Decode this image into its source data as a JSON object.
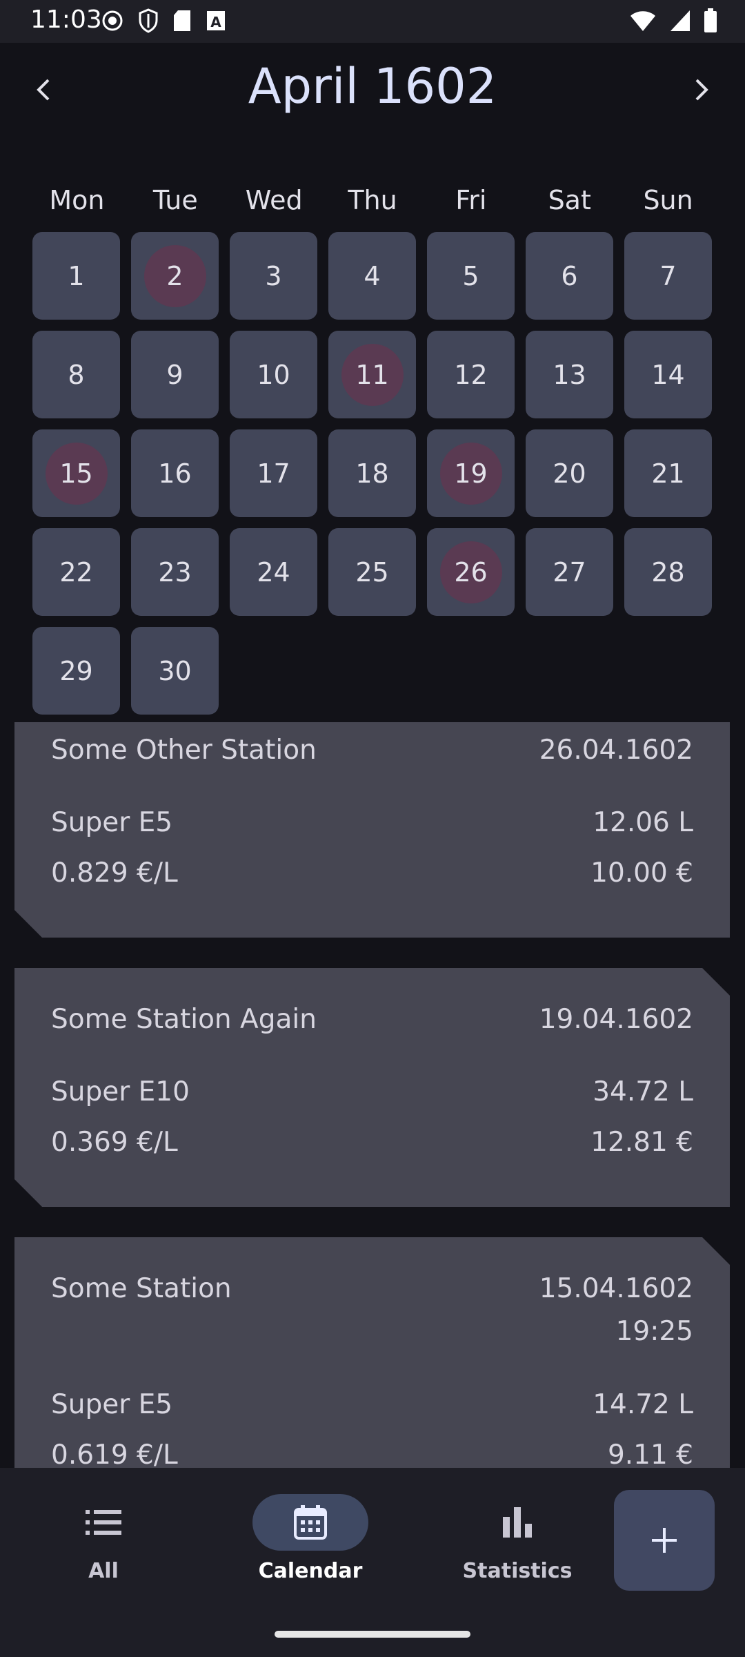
{
  "status_bar": {
    "time": "11:03"
  },
  "header": {
    "month_title": "April 1602"
  },
  "weekdays": [
    "Mon",
    "Tue",
    "Wed",
    "Thu",
    "Fri",
    "Sat",
    "Sun"
  ],
  "days": [
    {
      "label": "1",
      "hl": false
    },
    {
      "label": "2",
      "hl": true
    },
    {
      "label": "3",
      "hl": false
    },
    {
      "label": "4",
      "hl": false
    },
    {
      "label": "5",
      "hl": false
    },
    {
      "label": "6",
      "hl": false
    },
    {
      "label": "7",
      "hl": false
    },
    {
      "label": "8",
      "hl": false
    },
    {
      "label": "9",
      "hl": false
    },
    {
      "label": "10",
      "hl": false
    },
    {
      "label": "11",
      "hl": true
    },
    {
      "label": "12",
      "hl": false
    },
    {
      "label": "13",
      "hl": false
    },
    {
      "label": "14",
      "hl": false
    },
    {
      "label": "15",
      "hl": true
    },
    {
      "label": "16",
      "hl": false
    },
    {
      "label": "17",
      "hl": false
    },
    {
      "label": "18",
      "hl": false
    },
    {
      "label": "19",
      "hl": true
    },
    {
      "label": "20",
      "hl": false
    },
    {
      "label": "21",
      "hl": false
    },
    {
      "label": "22",
      "hl": false
    },
    {
      "label": "23",
      "hl": false
    },
    {
      "label": "24",
      "hl": false
    },
    {
      "label": "25",
      "hl": false
    },
    {
      "label": "26",
      "hl": true
    },
    {
      "label": "27",
      "hl": false
    },
    {
      "label": "28",
      "hl": false
    },
    {
      "label": "29",
      "hl": false
    },
    {
      "label": "30",
      "hl": false
    }
  ],
  "entries": [
    {
      "station": "Some Other Station",
      "date": "26.04.1602",
      "time": "",
      "fuel": "Super E5",
      "liters": "12.06 L",
      "price_per_liter": "0.829 €/L",
      "total": "10.00 €"
    },
    {
      "station": "Some Station Again",
      "date": "19.04.1602",
      "time": "",
      "fuel": "Super E10",
      "liters": "34.72 L",
      "price_per_liter": "0.369 €/L",
      "total": "12.81 €"
    },
    {
      "station": "Some Station",
      "date": "15.04.1602",
      "time": "19:25",
      "fuel": "Super E5",
      "liters": "14.72 L",
      "price_per_liter": "0.619 €/L",
      "total": "9.11 €"
    }
  ],
  "bottom_nav": {
    "all_label": "All",
    "calendar_label": "Calendar",
    "statistics_label": "Statistics"
  },
  "colors": {
    "highlight": "#5a3a52",
    "day_bg": "#424659",
    "card_bg": "#464652"
  }
}
